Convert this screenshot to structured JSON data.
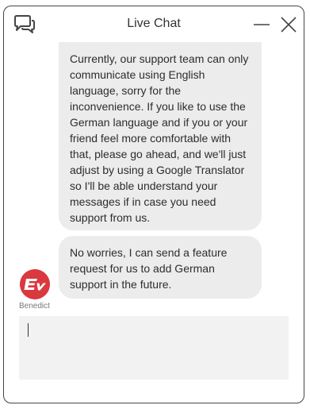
{
  "header": {
    "title": "Live Chat",
    "chat_icon": "chat-bubbles-icon",
    "minimize_icon": "minimize-icon",
    "close_icon": "close-icon"
  },
  "messages": [
    {
      "sender": "agent",
      "text": "Currently, our support team can only communicate using English language, sorry for the inconvenience. If you like to use the German language and if you or your friend feel more comfortable with that, please go ahead, and we'll just adjust by using a Google Translator so I'll be able understand your messages if in case you need support from us."
    },
    {
      "sender": "agent",
      "text": "No worries, I can send a feature request for us to add German support in the future."
    }
  ],
  "agent": {
    "name": "Benedict",
    "avatar_icon": "expressvpn-logo-icon",
    "avatar_color": "#da3940"
  },
  "composer": {
    "value": "",
    "placeholder": ""
  }
}
